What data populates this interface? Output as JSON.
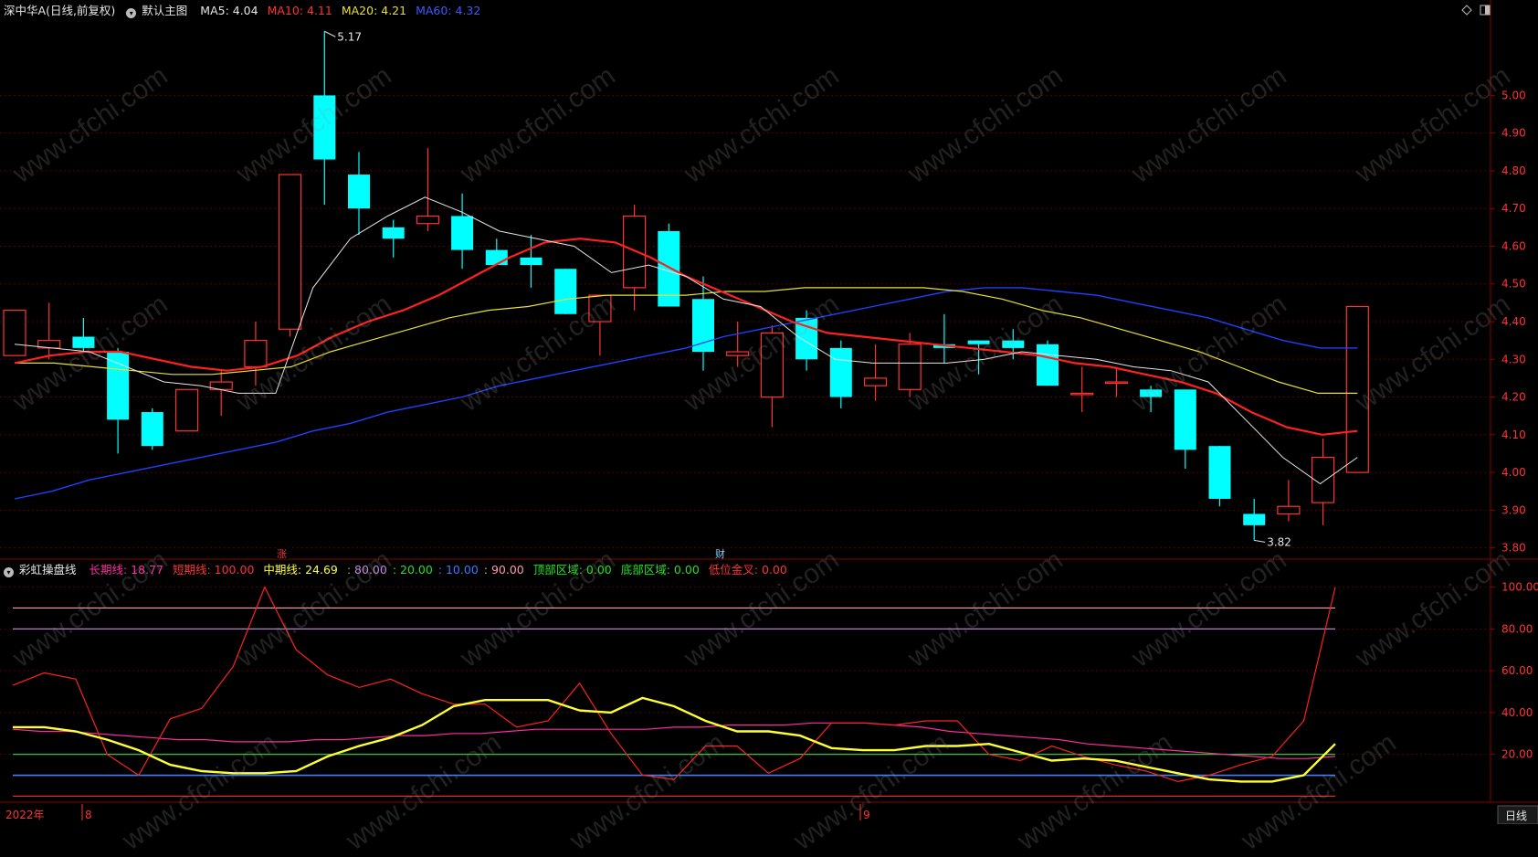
{
  "header": {
    "stock_name": "深中华A",
    "period_mode": "(日线,前复权)",
    "template_name": "默认主图",
    "ma5": "MA5: 4.04",
    "ma10": "MA10: 4.11",
    "ma20": "MA20: 4.21",
    "ma60": "MA60: 4.32"
  },
  "indicator": {
    "name": "彩虹操盘线",
    "long_line": "长期线: 18.77",
    "short_line": "短期线: 100.00",
    "mid_line": "中期线: 24.69",
    "level_80": ": 80.00",
    "level_20": ": 20.00",
    "level_10": ": 10.00",
    "level_90": ": 90.00",
    "top_zone": "顶部区域: 0.00",
    "bottom_zone": "底部区域: 0.00",
    "low_gold_cross": "低位金叉: 0.00"
  },
  "annotations": {
    "high": "5.17",
    "low": "3.82",
    "marker_up": "涨",
    "marker_fin": "财"
  },
  "time_axis": {
    "year_label": "2022年",
    "month_8": "8",
    "month_9": "9",
    "period_button": "日线"
  },
  "colors": {
    "up": "#ff3232",
    "down": "#00ffff",
    "ma5": "#e6e6e6",
    "ma10": "#ff2020",
    "ma20": "#e8e030",
    "ma60": "#2040ff",
    "grid": "#5a0000",
    "axis_text": "#ff3232"
  },
  "watermark": "www.cfchi.com",
  "chart_data": [
    {
      "type": "candlestick",
      "price_axis_ticks": [
        "5.00",
        "4.90",
        "4.80",
        "4.70",
        "4.60",
        "4.50",
        "4.40",
        "4.30",
        "4.20",
        "4.10",
        "4.00",
        "3.90",
        "3.80"
      ],
      "ylim": [
        3.77,
        5.19
      ],
      "candles": [
        {
          "o": 4.31,
          "h": 4.43,
          "l": 4.31,
          "c": 4.43
        },
        {
          "o": 4.33,
          "h": 4.45,
          "l": 4.3,
          "c": 4.35
        },
        {
          "o": 4.36,
          "h": 4.41,
          "l": 4.32,
          "c": 4.33
        },
        {
          "o": 4.32,
          "h": 4.33,
          "l": 4.05,
          "c": 4.14
        },
        {
          "o": 4.16,
          "h": 4.17,
          "l": 4.06,
          "c": 4.07
        },
        {
          "o": 4.11,
          "h": 4.22,
          "l": 4.11,
          "c": 4.22
        },
        {
          "o": 4.22,
          "h": 4.27,
          "l": 4.15,
          "c": 4.24
        },
        {
          "o": 4.28,
          "h": 4.4,
          "l": 4.23,
          "c": 4.35
        },
        {
          "o": 4.38,
          "h": 4.79,
          "l": 4.36,
          "c": 4.79
        },
        {
          "o": 5.0,
          "h": 5.17,
          "l": 4.71,
          "c": 4.83
        },
        {
          "o": 4.79,
          "h": 4.85,
          "l": 4.63,
          "c": 4.7
        },
        {
          "o": 4.65,
          "h": 4.67,
          "l": 4.57,
          "c": 4.62
        },
        {
          "o": 4.66,
          "h": 4.86,
          "l": 4.64,
          "c": 4.68
        },
        {
          "o": 4.68,
          "h": 4.74,
          "l": 4.54,
          "c": 4.59
        },
        {
          "o": 4.59,
          "h": 4.62,
          "l": 4.55,
          "c": 4.55
        },
        {
          "o": 4.57,
          "h": 4.63,
          "l": 4.49,
          "c": 4.55
        },
        {
          "o": 4.54,
          "h": 4.54,
          "l": 4.42,
          "c": 4.42
        },
        {
          "o": 4.4,
          "h": 4.47,
          "l": 4.31,
          "c": 4.47
        },
        {
          "o": 4.49,
          "h": 4.71,
          "l": 4.43,
          "c": 4.68
        },
        {
          "o": 4.64,
          "h": 4.66,
          "l": 4.44,
          "c": 4.44
        },
        {
          "o": 4.46,
          "h": 4.52,
          "l": 4.27,
          "c": 4.32
        },
        {
          "o": 4.31,
          "h": 4.4,
          "l": 4.28,
          "c": 4.32
        },
        {
          "o": 4.2,
          "h": 4.39,
          "l": 4.12,
          "c": 4.37
        },
        {
          "o": 4.41,
          "h": 4.43,
          "l": 4.27,
          "c": 4.3
        },
        {
          "o": 4.33,
          "h": 4.35,
          "l": 4.17,
          "c": 4.2
        },
        {
          "o": 4.23,
          "h": 4.34,
          "l": 4.19,
          "c": 4.25
        },
        {
          "o": 4.22,
          "h": 4.37,
          "l": 4.2,
          "c": 4.34
        },
        {
          "o": 4.34,
          "h": 4.42,
          "l": 4.29,
          "c": 4.33
        },
        {
          "o": 4.35,
          "h": 4.35,
          "l": 4.26,
          "c": 4.34
        },
        {
          "o": 4.35,
          "h": 4.38,
          "l": 4.3,
          "c": 4.33
        },
        {
          "o": 4.34,
          "h": 4.35,
          "l": 4.23,
          "c": 4.23
        },
        {
          "o": 4.21,
          "h": 4.28,
          "l": 4.16,
          "c": 4.21
        },
        {
          "o": 4.24,
          "h": 4.28,
          "l": 4.2,
          "c": 4.24
        },
        {
          "o": 4.22,
          "h": 4.23,
          "l": 4.16,
          "c": 4.2
        },
        {
          "o": 4.22,
          "h": 4.22,
          "l": 4.01,
          "c": 4.06
        },
        {
          "o": 4.07,
          "h": 4.07,
          "l": 3.91,
          "c": 3.93
        },
        {
          "o": 3.89,
          "h": 3.93,
          "l": 3.82,
          "c": 3.86
        },
        {
          "o": 3.89,
          "h": 3.98,
          "l": 3.87,
          "c": 3.91
        },
        {
          "o": 3.92,
          "h": 4.09,
          "l": 3.86,
          "c": 4.04
        },
        {
          "o": 4.0,
          "h": 4.44,
          "l": 4.0,
          "c": 4.44
        }
      ],
      "ma5": [
        4.34,
        4.33,
        4.32,
        4.28,
        4.24,
        4.23,
        4.21,
        4.21,
        4.49,
        4.62,
        4.68,
        4.73,
        4.69,
        4.64,
        4.62,
        4.6,
        4.53,
        4.55,
        4.52,
        4.46,
        4.44,
        4.36,
        4.3,
        4.29,
        4.29,
        4.29,
        4.3,
        4.32,
        4.31,
        4.3,
        4.28,
        4.27,
        4.24,
        4.14,
        4.04,
        3.97,
        4.04
      ],
      "ma10": [
        4.29,
        4.31,
        4.32,
        4.32,
        4.3,
        4.28,
        4.27,
        4.28,
        4.31,
        4.36,
        4.4,
        4.43,
        4.47,
        4.52,
        4.57,
        4.61,
        4.62,
        4.61,
        4.57,
        4.52,
        4.48,
        4.44,
        4.4,
        4.37,
        4.36,
        4.35,
        4.34,
        4.33,
        4.32,
        4.31,
        4.29,
        4.28,
        4.26,
        4.24,
        4.21,
        4.16,
        4.12,
        4.1,
        4.11
      ],
      "ma20": [
        4.29,
        4.29,
        4.28,
        4.27,
        4.26,
        4.26,
        4.27,
        4.28,
        4.32,
        4.35,
        4.38,
        4.41,
        4.43,
        4.44,
        4.46,
        4.47,
        4.47,
        4.47,
        4.48,
        4.48,
        4.49,
        4.49,
        4.49,
        4.49,
        4.48,
        4.46,
        4.43,
        4.41,
        4.38,
        4.35,
        4.32,
        4.28,
        4.24,
        4.21,
        4.21
      ],
      "ma60": [
        3.93,
        3.95,
        3.98,
        4.0,
        4.02,
        4.04,
        4.06,
        4.08,
        4.11,
        4.13,
        4.16,
        4.18,
        4.2,
        4.23,
        4.25,
        4.27,
        4.29,
        4.31,
        4.33,
        4.36,
        4.38,
        4.4,
        4.42,
        4.44,
        4.46,
        4.48,
        4.49,
        4.49,
        4.48,
        4.47,
        4.45,
        4.43,
        4.41,
        4.38,
        4.35,
        4.33,
        4.33
      ]
    },
    {
      "type": "line",
      "name": "彩虹操盘线",
      "y_axis_ticks": [
        "100.00",
        "80.00",
        "60.00",
        "40.00",
        "20.00"
      ],
      "ylim": [
        -2,
        102
      ],
      "levels": [
        90,
        80,
        20,
        10,
        0
      ],
      "series": [
        {
          "name": "长期线",
          "color": "#ff2aa0",
          "values": [
            32,
            31,
            31,
            30,
            29,
            28,
            27,
            27,
            26,
            26,
            26,
            27,
            27,
            28,
            29,
            29,
            30,
            30,
            31,
            32,
            32,
            32,
            32,
            32,
            33,
            33,
            34,
            34,
            34,
            35,
            35,
            35,
            34,
            33,
            31,
            30,
            29,
            28,
            27,
            25,
            24,
            23,
            22,
            21,
            20,
            19,
            18,
            18,
            19
          ]
        },
        {
          "name": "短期线",
          "color": "#ff2020",
          "values": [
            53,
            59,
            56,
            20,
            10,
            37,
            42,
            62,
            100,
            70,
            58,
            52,
            56,
            49,
            44,
            44,
            33,
            36,
            54,
            30,
            10,
            8,
            24,
            24,
            11,
            18,
            35,
            35,
            34,
            36,
            36,
            20,
            17,
            24,
            19,
            15,
            12,
            7,
            10,
            15,
            19,
            36,
            100
          ]
        },
        {
          "name": "中期线",
          "color": "#ffff30",
          "values": [
            33,
            33,
            31,
            27,
            22,
            15,
            12,
            11,
            11,
            12,
            19,
            24,
            28,
            34,
            43,
            46,
            46,
            46,
            41,
            40,
            47,
            43,
            36,
            31,
            31,
            29,
            23,
            22,
            22,
            24,
            24,
            25,
            21,
            17,
            18,
            17,
            14,
            11,
            8,
            7,
            7,
            10,
            25
          ]
        }
      ]
    }
  ]
}
